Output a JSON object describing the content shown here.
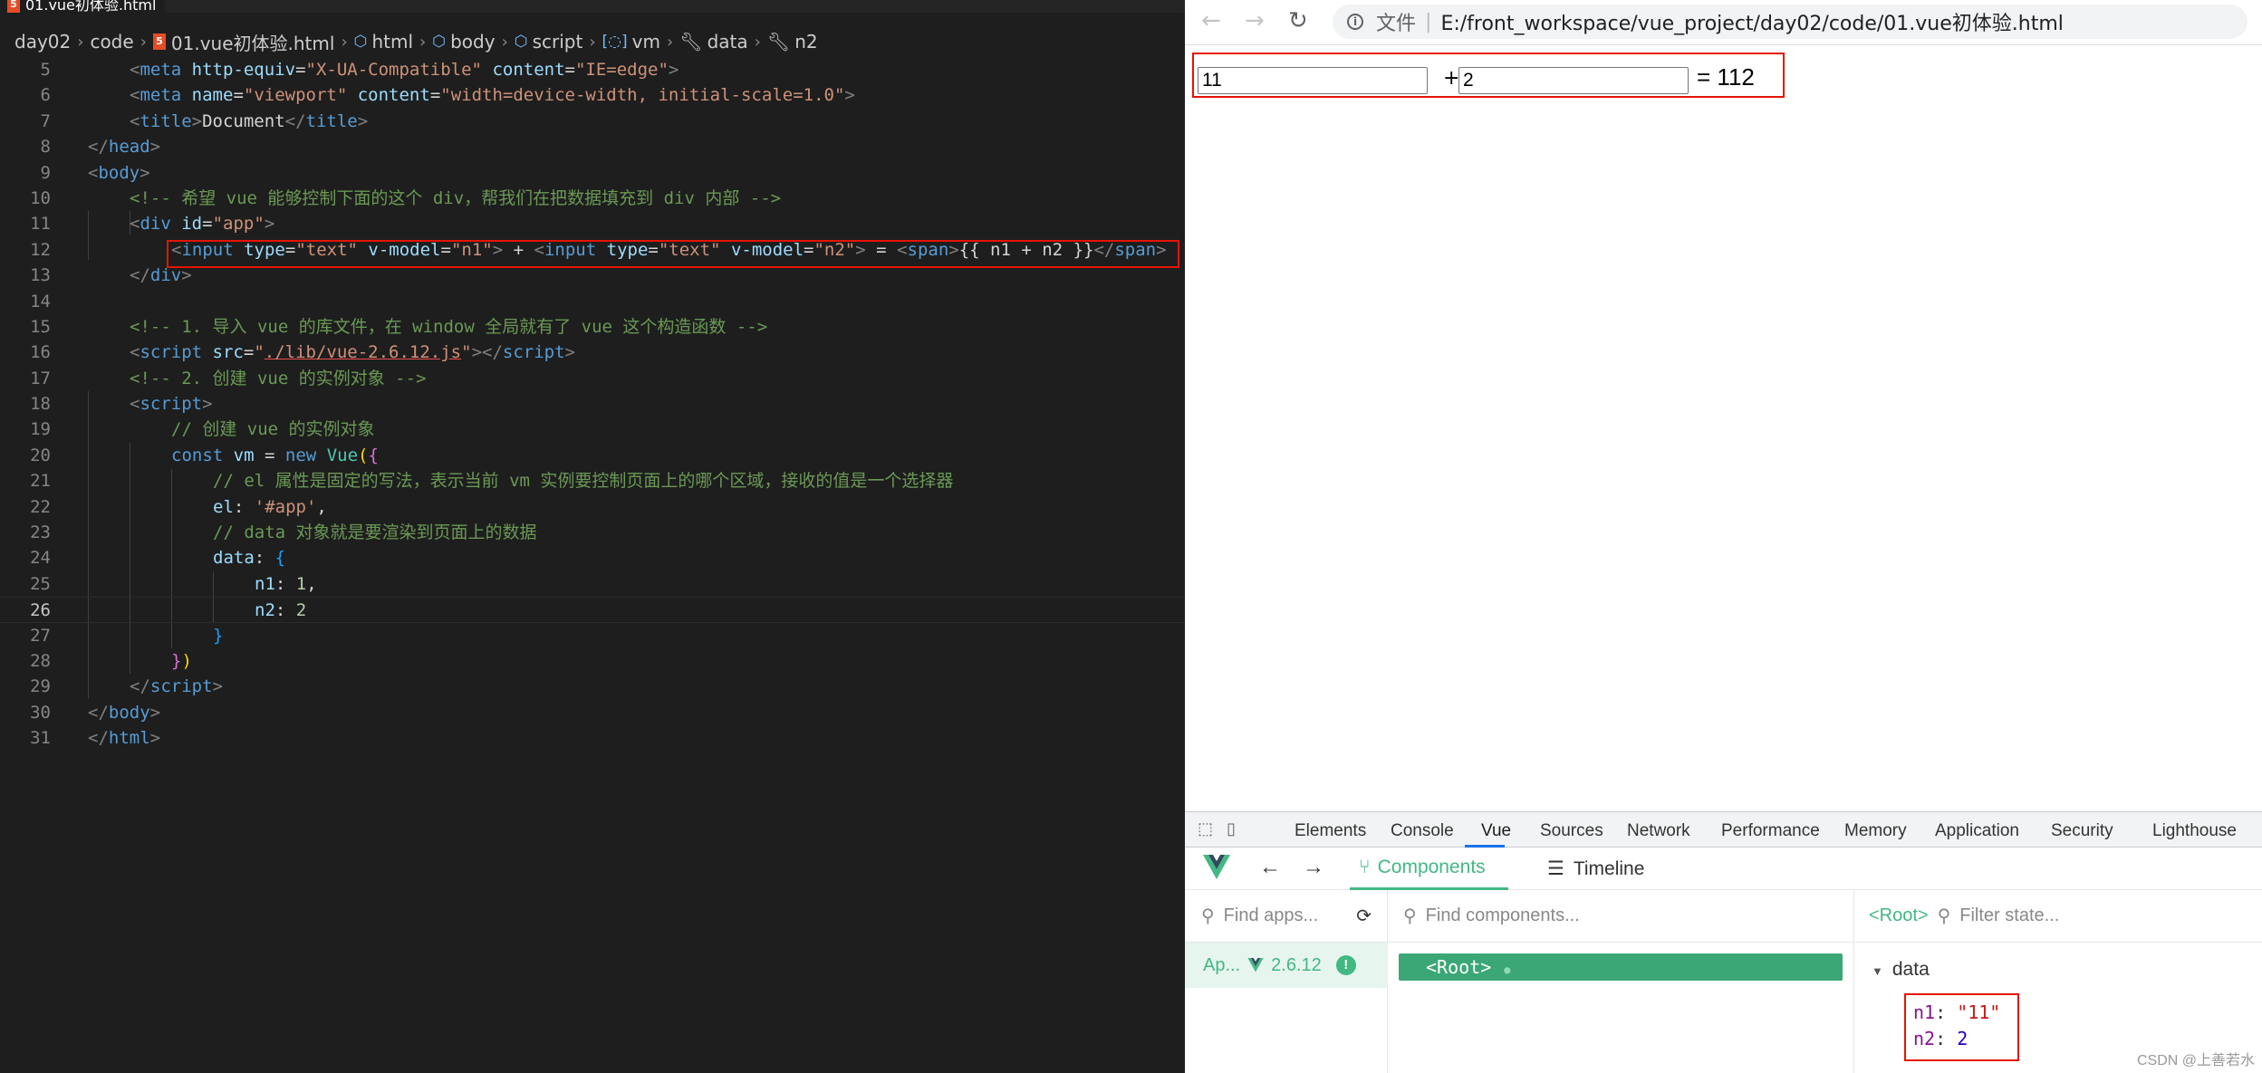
{
  "editor": {
    "tab_title": "01.vue初体验.html",
    "tab_icon": "5",
    "breadcrumb": [
      "day02",
      "code",
      "01.vue初体验.html",
      "html",
      "body",
      "script",
      "vm",
      "data",
      "n2"
    ],
    "lines": [
      {
        "no": "5"
      },
      {
        "no": "6"
      },
      {
        "no": "7"
      },
      {
        "no": "8"
      },
      {
        "no": "9"
      },
      {
        "no": "10"
      },
      {
        "no": "11"
      },
      {
        "no": "12"
      },
      {
        "no": "13"
      },
      {
        "no": "14"
      },
      {
        "no": "15"
      },
      {
        "no": "16"
      },
      {
        "no": "17"
      },
      {
        "no": "18"
      },
      {
        "no": "19"
      },
      {
        "no": "20"
      },
      {
        "no": "21"
      },
      {
        "no": "22"
      },
      {
        "no": "23"
      },
      {
        "no": "24"
      },
      {
        "no": "25"
      },
      {
        "no": "26"
      },
      {
        "no": "27"
      },
      {
        "no": "28"
      },
      {
        "no": "29"
      },
      {
        "no": "30"
      },
      {
        "no": "31"
      }
    ],
    "current_line": "26",
    "code": {
      "l5": {
        "tag": "meta",
        "a1": "http-equiv",
        "v1": "\"X-UA-Compatible\"",
        "a2": "content",
        "v2": "\"IE=edge\""
      },
      "l6": {
        "tag": "meta",
        "a1": "name",
        "v1": "\"viewport\"",
        "a2": "content",
        "v2": "\"width=device-width, initial-scale=1.0\""
      },
      "l7": {
        "tag": "title",
        "text": "Document"
      },
      "l8": {
        "tag": "head"
      },
      "l9": {
        "tag": "body"
      },
      "l10": {
        "comment": "<!-- 希望 vue 能够控制下面的这个 div，帮我们在把数据填充到 div 内部 -->"
      },
      "l11": {
        "tag": "div",
        "a1": "id",
        "v1": "\"app\""
      },
      "l12": {
        "tag": "input",
        "a1": "type",
        "v1": "\"text\"",
        "a2": "v-model",
        "v2": "\"n1\"",
        "v3": "\"n2\"",
        "plus": "+",
        "eq": "=",
        "span": "span",
        "expr": "{{ n1 + n2 }}"
      },
      "l13": {
        "tag": "div"
      },
      "l15": {
        "comment": "<!-- 1. 导入 vue 的库文件，在 window 全局就有了 vue 这个构造函数 -->"
      },
      "l16": {
        "tag": "script",
        "a1": "src",
        "src": "./lib/vue-2.6.12.js"
      },
      "l17": {
        "comment": "<!-- 2. 创建 vue 的实例对象 -->"
      },
      "l18": {
        "tag": "script"
      },
      "l19": {
        "comment": "// 创建 vue 的实例对象"
      },
      "l20": {
        "kw1": "const",
        "var": "vm",
        "eq": "=",
        "kw2": "new",
        "cls": "Vue"
      },
      "l21": {
        "comment": "// el 属性是固定的写法，表示当前 vm 实例要控制页面上的哪个区域，接收的值是一个选择器"
      },
      "l22": {
        "key": "el",
        "val": "'#app'"
      },
      "l23": {
        "comment": "// data 对象就是要渲染到页面上的数据"
      },
      "l24": {
        "key": "data"
      },
      "l25": {
        "key": "n1",
        "val": "1"
      },
      "l26": {
        "key": "n2",
        "val": "2"
      },
      "l29": {
        "tag": "script"
      },
      "l30": {
        "tag": "body"
      },
      "l31": {
        "tag": "html"
      }
    }
  },
  "browser": {
    "url_prefix": "文件",
    "url": "E:/front_workspace/vue_project/day02/code/01.vue初体验.html",
    "input1_value": "11",
    "input2_value": "2",
    "plus": "+",
    "result": "= 112"
  },
  "devtools": {
    "tabs": [
      "Elements",
      "Console",
      "Vue",
      "Sources",
      "Network",
      "Performance",
      "Memory",
      "Application",
      "Security",
      "Lighthouse"
    ],
    "active_tab": "Vue",
    "vue_tabs": {
      "components": "Components",
      "timeline": "Timeline"
    },
    "find_apps_placeholder": "Find apps...",
    "find_components_placeholder": "Find components...",
    "filter_state_placeholder": "Filter state...",
    "app_label": "Ap...",
    "vue_version": "2.6.12",
    "root_component": "<Root>",
    "root_label": "<Root>",
    "data_section": "data",
    "state": [
      {
        "key": "n1",
        "value": "\"11\""
      },
      {
        "key": "n2",
        "value": "2"
      }
    ]
  },
  "watermark": "CSDN @上善若水",
  "colors": {
    "accent_red": "#e51400",
    "vue_green": "#42b883"
  }
}
